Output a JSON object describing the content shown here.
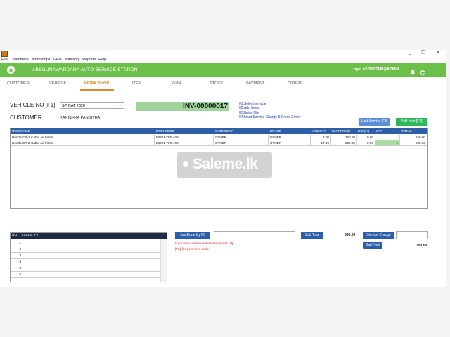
{
  "window": {
    "minimize": "_",
    "restore": "❐",
    "close": "✕"
  },
  "menu": [
    "File",
    "Customers",
    "Workshops",
    "GRN",
    "Warranty",
    "Reports",
    "Help"
  ],
  "header": {
    "station": "ABEGUNAWARDANA AUTO SERVICE STATION",
    "login": "Login AS SYSTEM@ADMIN",
    "brand_color": "#6cc04a"
  },
  "tabs": [
    "CUSTOMER",
    "VEHICLE",
    "WORK SHOP",
    "ITEM",
    "GRN",
    "STOCK",
    "PAYMENT",
    "CONFIG"
  ],
  "active_tab": "WORK SHOP",
  "form": {
    "vehicle_label": "VEHICLE NO [F1]",
    "vehicle_value": "SP CAT 2020",
    "invoice": "INV-00000017",
    "customer_label": "CUSTOMER",
    "customer_name": "KANISHKA PANDITHA",
    "steps": [
      "01.Select Vehicle",
      "02.Add Items",
      "03.Enter Qty",
      "04.Input Service Charge & Press Enter"
    ],
    "last_service_button": "Last Service [F8]",
    "add_item_button": "Add Item [F2]"
  },
  "items_table": {
    "columns": [
      "ITEM NAME",
      "ITEM CODE",
      "CATEGORY",
      "BRAND",
      "AVB QTY",
      "UNIT PRICE",
      "DIS (%)",
      "QTY",
      "TOTAL"
    ],
    "rows": [
      [
        "Honda CR-Z Cabin Air Filters",
        "80291-TF0-405",
        "OTHER",
        "OTHER",
        "2.00",
        "150.00",
        "0.00",
        "1",
        "150.00"
      ],
      [
        "Honda CR-Z Cabin Air Filters",
        "80291-TF0-405",
        "OTHER",
        "OTHER",
        "17.00",
        "200.00",
        "0.00",
        "1",
        "200.00"
      ]
    ]
  },
  "watermark": "Saleme.lk",
  "issue_table": {
    "columns": [
      "NO",
      "ISSUE [F7]"
    ],
    "rows": [
      "1",
      "2",
      "3",
      "4",
      "5",
      "6"
    ]
  },
  "bottom": {
    "job_done_button": "Job Done By F3",
    "hint1": "If you want delete select item press [D]",
    "hint2": "[F6] for goto item table",
    "sub_total_button": "Sub Total",
    "sub_total_value": "350.00",
    "service_charge_button": "Service Charge",
    "subtotal_label": "SubTotal",
    "subtotal_value": "350.00"
  }
}
